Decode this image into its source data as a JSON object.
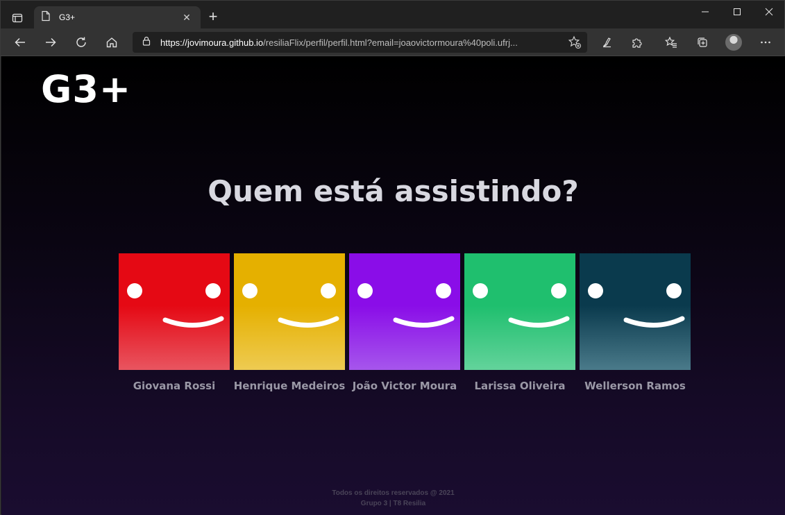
{
  "browser": {
    "tab_title": "G3+",
    "url_scheme": "https://",
    "url_host": "jovimoura.github.io",
    "url_path": "/resiliaFlix/perfil/perfil.html?email=joaovictormoura%40poli.ufrj..."
  },
  "page": {
    "logo": "G3+",
    "heading": "Quem está assistindo?",
    "profiles": [
      {
        "name": "Giovana Rossi",
        "color_top": "#e50914",
        "color_bottom": "#e85560"
      },
      {
        "name": "Henrique Medeiros",
        "color_top": "#e5b000",
        "color_bottom": "#eecb52"
      },
      {
        "name": "João Victor Moura",
        "color_top": "#8a0de8",
        "color_bottom": "#a656ec"
      },
      {
        "name": "Larissa Oliveira",
        "color_top": "#1fbf6e",
        "color_bottom": "#63d39b"
      },
      {
        "name": "Wellerson Ramos",
        "color_top": "#0a3a4d",
        "color_bottom": "#4a7a8a"
      }
    ],
    "footer_line1": "Todos os direitos reservados @ 2021",
    "footer_line2": "Grupo 3 | T8 Resilia"
  },
  "icons": {
    "tab_actions": "tab-actions-icon",
    "page": "page-icon",
    "back": "arrow-left-icon",
    "forward": "arrow-right-icon",
    "refresh": "refresh-icon",
    "home": "home-icon",
    "lock": "lock-icon",
    "favorite_add": "star-plus-icon",
    "extensions": "puzzle-icon",
    "favorites": "favorites-icon",
    "collections": "collections-icon",
    "more": "more-icon"
  }
}
